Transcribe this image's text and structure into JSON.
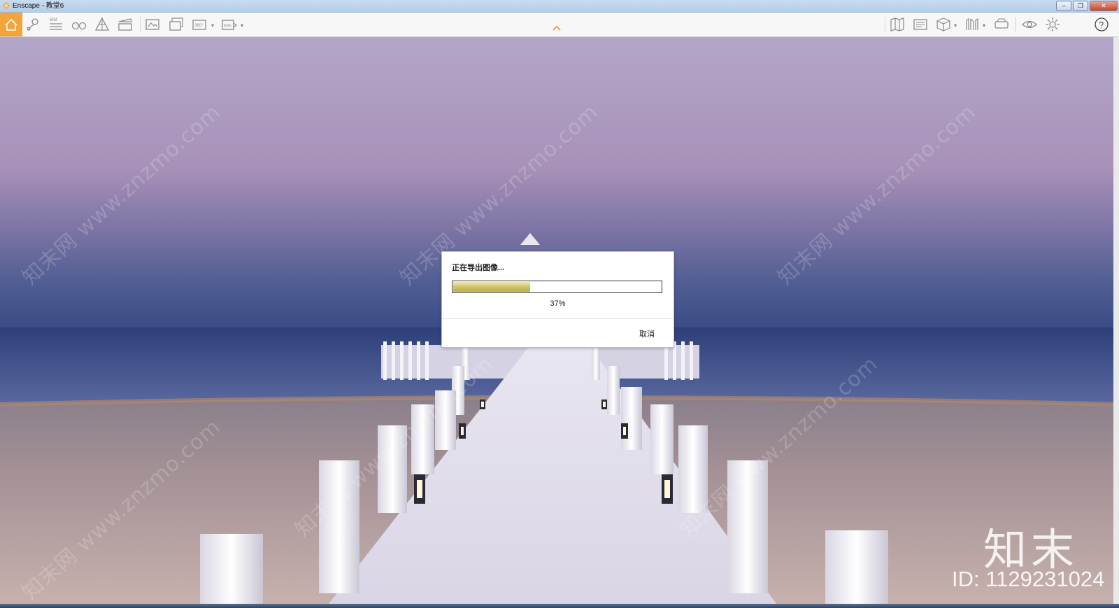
{
  "window": {
    "title": "Enscape - 教堂6",
    "controls": [
      "minimize",
      "restore",
      "close"
    ]
  },
  "toolbar": {
    "left_icons": [
      "home-icon",
      "location-icon",
      "bim-icon",
      "binoculars-icon",
      "perspective-icon",
      "clapper-icon",
      "render-image-icon",
      "batch-render-icon",
      "panorama-360-icon",
      "export-exe-icon"
    ],
    "bim_label": "BIM",
    "pano_label": "360°",
    "exe_label": "EXE",
    "right_icons": [
      "map-icon",
      "gallery-icon",
      "cube-view-icon",
      "asset-library-icon",
      "vr-headset-icon",
      "visual-settings-icon",
      "settings-gear-icon",
      "help-icon"
    ]
  },
  "dialog": {
    "title": "正在导出图像...",
    "progress_fraction": 0.37,
    "progress_text": "37%",
    "cancel_label": "取消"
  },
  "watermarks": {
    "diagonal_text": "知末网 www.znzmo.com",
    "logo_text": "知末",
    "id_text": "ID: 1129231024"
  },
  "colors": {
    "accent_orange": "#f5a43b",
    "progress_fill": "#cfc46a"
  }
}
